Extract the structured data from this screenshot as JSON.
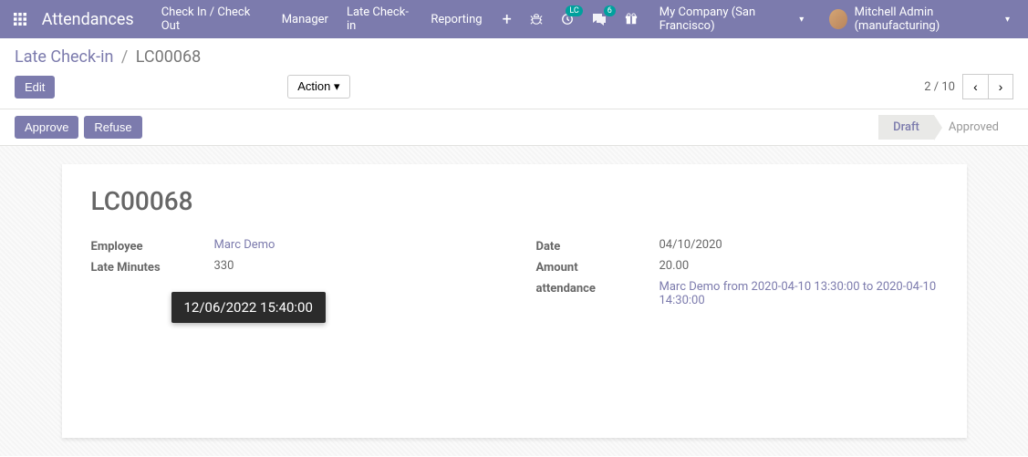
{
  "navbar": {
    "app_title": "Attendances",
    "menu": [
      "Check In / Check Out",
      "Manager",
      "Late Check-in",
      "Reporting"
    ],
    "badge_lc": "LC",
    "badge_msg": "6",
    "company": "My Company (San Francisco)",
    "user": "Mitchell Admin (manufacturing)"
  },
  "breadcrumb": {
    "parent": "Late Check-in",
    "current": "LC00068"
  },
  "buttons": {
    "edit": "Edit",
    "action": "Action",
    "approve": "Approve",
    "refuse": "Refuse"
  },
  "pager": {
    "text": "2 / 10"
  },
  "statusbar": {
    "draft": "Draft",
    "approved": "Approved"
  },
  "record": {
    "title": "LC00068",
    "employee_label": "Employee",
    "employee_value": "Marc Demo",
    "late_minutes_label": "Late Minutes",
    "late_minutes_value": "330",
    "date_label": "Date",
    "date_value": "04/10/2020",
    "amount_label": "Amount",
    "amount_value": "20.00",
    "attendance_label": "attendance",
    "attendance_value": "Marc Demo from 2020-04-10 13:30:00 to 2020-04-10 14:30:00"
  },
  "tooltip": "12/06/2022 15:40:00"
}
